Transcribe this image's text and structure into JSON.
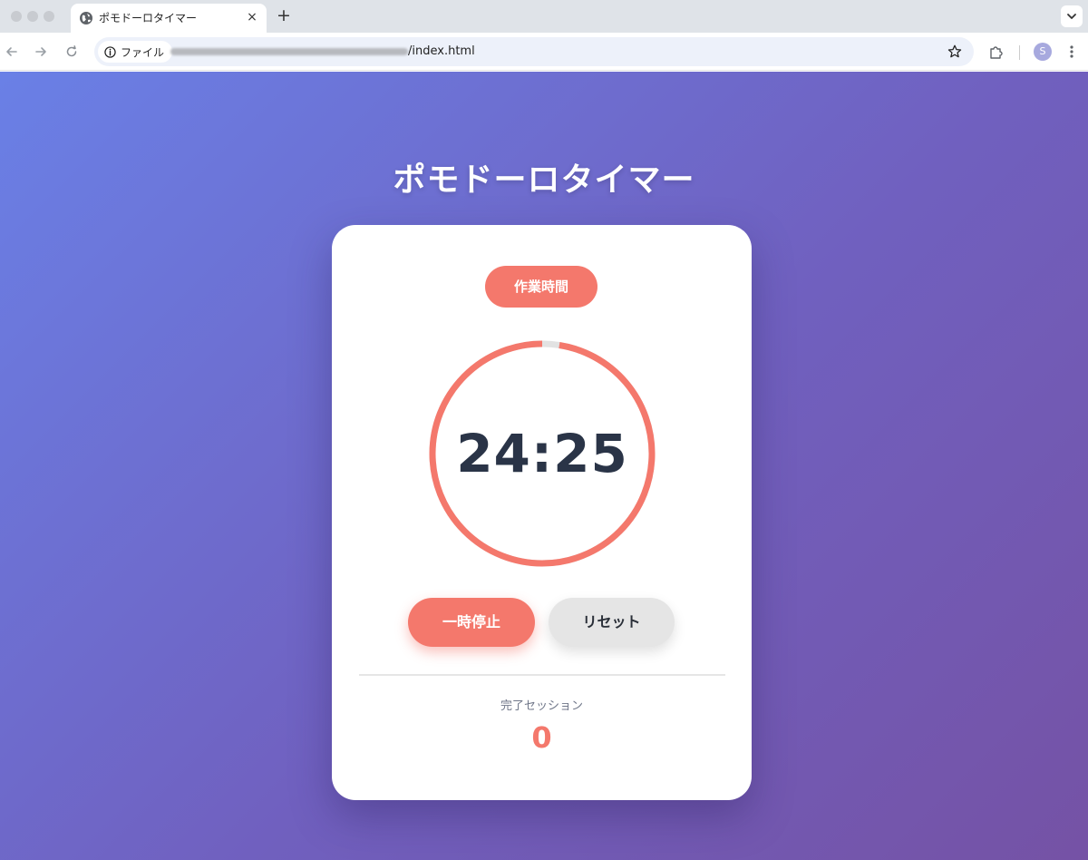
{
  "browser": {
    "tab_title": "ポモドーロタイマー",
    "new_tab_symbol": "+",
    "close_symbol": "×",
    "security_chip_label": "ファイル",
    "url_visible": "/index.html",
    "avatar_initial": "S"
  },
  "app": {
    "title": "ポモドーロタイマー",
    "mode_label": "作業時間",
    "time_remaining": "24:25",
    "progress_fraction": 0.975,
    "pause_label": "一時停止",
    "reset_label": "リセット",
    "sessions_label": "完了セッション",
    "sessions_count": "0"
  },
  "colors": {
    "accent": "#f4786c",
    "text_dark": "#2a3447",
    "track": "#e2e2e2",
    "bg_gradient_start": "#6a80e6",
    "bg_gradient_end": "#7552a5"
  }
}
